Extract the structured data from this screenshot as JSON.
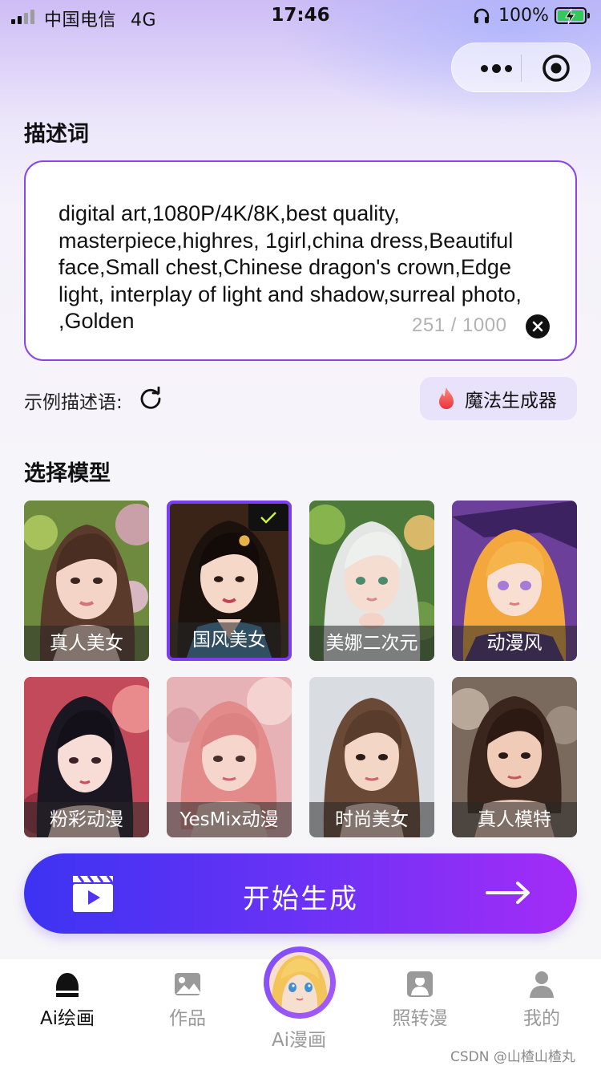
{
  "status_bar": {
    "carrier": "中国电信",
    "network": "4G",
    "time": "17:46",
    "battery": "100%"
  },
  "prompt": {
    "title": "描述词",
    "text": "digital art,1080P/4K/8K,best quality, masterpiece,highres, 1girl,china dress,Beautiful face,Small chest,Chinese dragon's crown,Edge light, interplay of light and shadow,surreal photo, ,Golden",
    "counter": "251 / 1000"
  },
  "examples": {
    "label": "示例描述语:"
  },
  "magic_button": {
    "label": "魔法生成器"
  },
  "models": {
    "title": "选择模型",
    "selected_index": 1,
    "items": [
      {
        "label": "真人美女"
      },
      {
        "label": "国风美女"
      },
      {
        "label": "美娜二次元"
      },
      {
        "label": "动漫风"
      },
      {
        "label": "粉彩动漫"
      },
      {
        "label": "YesMix动漫"
      },
      {
        "label": "时尚美女"
      },
      {
        "label": "真人模特"
      }
    ]
  },
  "generate": {
    "label": "开始生成"
  },
  "tabs": [
    {
      "label": "Ai绘画",
      "icon": "home-icon",
      "active": true
    },
    {
      "label": "作品",
      "icon": "gallery-icon",
      "active": false
    },
    {
      "label": "照转漫",
      "icon": "photo-to-anime-icon",
      "active": false
    },
    {
      "label": "我的",
      "icon": "profile-icon",
      "active": false
    }
  ],
  "center_tab": {
    "label": "Ai漫画"
  },
  "watermark": "CSDN @山楂山楂丸",
  "colors": {
    "accent": "#7b3ef0",
    "gradient_start": "#3d33f2",
    "gradient_end": "#a42cf7",
    "battery": "#34c759"
  }
}
